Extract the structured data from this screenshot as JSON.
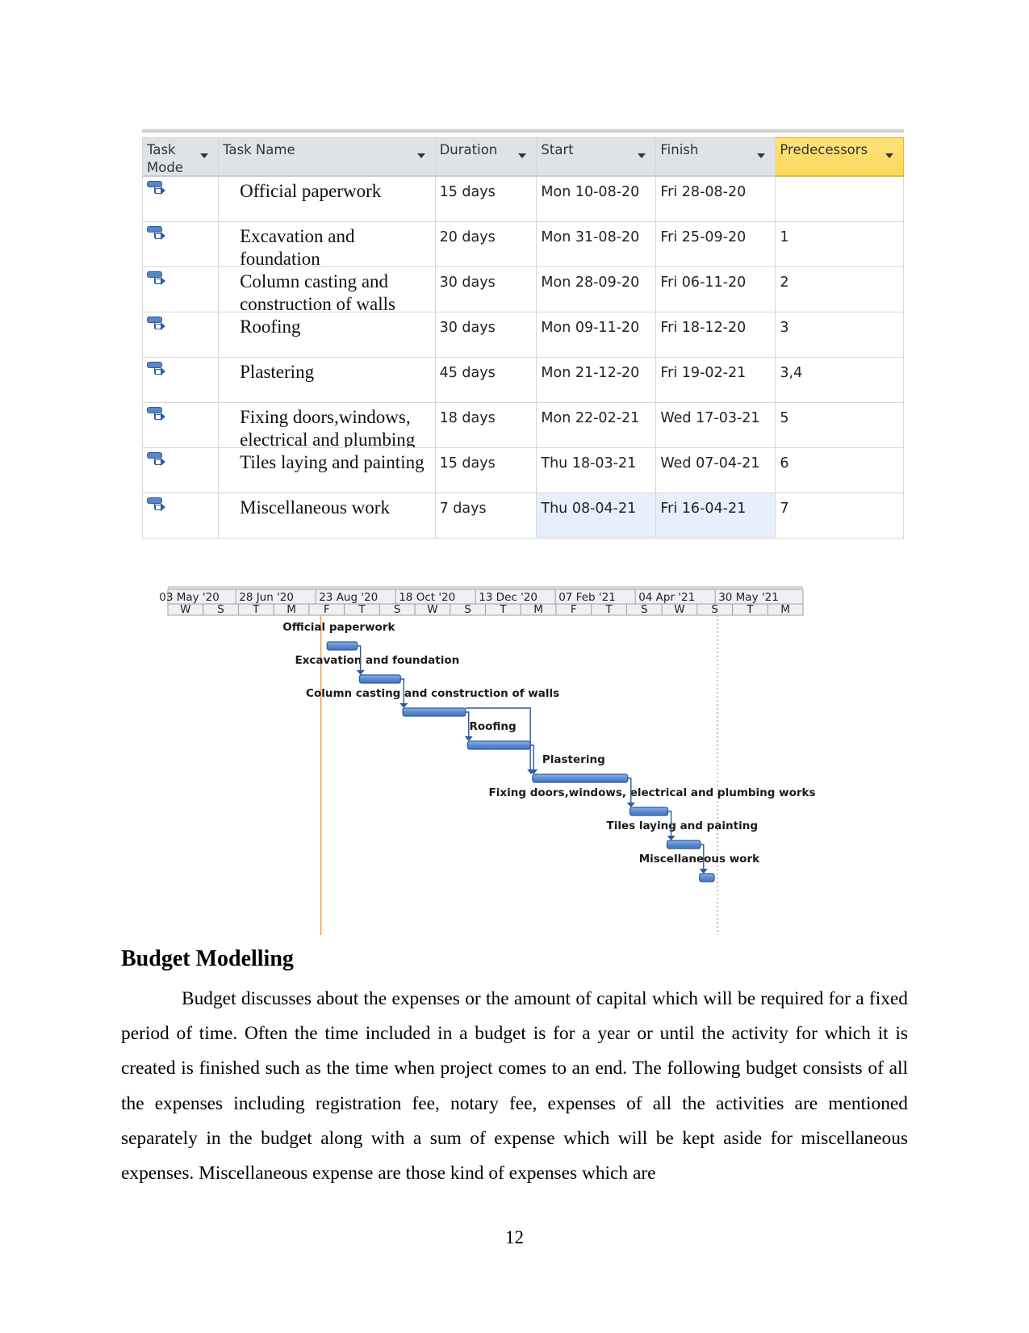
{
  "task_table": {
    "columns": [
      {
        "key": "mode",
        "label": "Task Mode",
        "line1": "Task",
        "line2": "Mode"
      },
      {
        "key": "name",
        "label": "Task Name"
      },
      {
        "key": "duration",
        "label": "Duration"
      },
      {
        "key": "start",
        "label": "Start"
      },
      {
        "key": "finish",
        "label": "Finish"
      },
      {
        "key": "predecessors",
        "label": "Predecessors"
      }
    ],
    "rows": [
      {
        "mode_icon": "auto-scheduled-task-icon",
        "name": "Official paperwork",
        "duration": "15 days",
        "start": "Mon 10-08-20",
        "finish": "Fri 28-08-20",
        "predecessors": ""
      },
      {
        "mode_icon": "auto-scheduled-task-icon",
        "name": "Excavation and foundation",
        "duration": "20 days",
        "start": "Mon 31-08-20",
        "finish": "Fri 25-09-20",
        "predecessors": "1"
      },
      {
        "mode_icon": "auto-scheduled-task-icon",
        "name": "Column casting and construction of walls",
        "duration": "30 days",
        "start": "Mon 28-09-20",
        "finish": "Fri 06-11-20",
        "predecessors": "2"
      },
      {
        "mode_icon": "auto-scheduled-task-icon",
        "name": "Roofing",
        "duration": "30 days",
        "start": "Mon 09-11-20",
        "finish": "Fri 18-12-20",
        "predecessors": "3"
      },
      {
        "mode_icon": "auto-scheduled-task-icon",
        "name": "Plastering",
        "duration": "45 days",
        "start": "Mon 21-12-20",
        "finish": "Fri 19-02-21",
        "predecessors": "3,4"
      },
      {
        "mode_icon": "auto-scheduled-task-icon",
        "name": "Fixing doors,windows, electrical and plumbing",
        "duration": "18 days",
        "start": "Mon 22-02-21",
        "finish": "Wed 17-03-21",
        "predecessors": "5"
      },
      {
        "mode_icon": "auto-scheduled-task-icon",
        "name": "Tiles laying and painting",
        "duration": "15 days",
        "start": "Thu 18-03-21",
        "finish": "Wed 07-04-21",
        "predecessors": "6"
      },
      {
        "mode_icon": "auto-scheduled-task-icon",
        "name": "Miscellaneous work",
        "duration": "7 days",
        "start": "Thu 08-04-21",
        "finish": "Fri 16-04-21",
        "predecessors": "7"
      }
    ],
    "selected_row": 7
  },
  "chart_data": {
    "type": "gantt",
    "title": "",
    "timescale_major": [
      "03 May '20",
      "28 Jun '20",
      "23 Aug '20",
      "18 Oct '20",
      "13 Dec '20",
      "07 Feb '21",
      "04 Apr '21",
      "30 May '21"
    ],
    "timescale_minor": [
      "W",
      "S",
      "T",
      "M",
      "F",
      "T",
      "S",
      "W",
      "S",
      "T",
      "M",
      "F",
      "T",
      "S",
      "W",
      "S",
      "T",
      "M"
    ],
    "axis_start": "2020-04-29",
    "axis_end": "2021-06-14",
    "today_line": "2020-08-06",
    "status_line": "2021-04-16",
    "tasks": [
      {
        "id": 1,
        "label": "Official paperwork",
        "start": "2020-08-10",
        "finish": "2020-08-28",
        "predecessors": []
      },
      {
        "id": 2,
        "label": "Excavation and foundation",
        "start": "2020-08-31",
        "finish": "2020-09-25",
        "predecessors": [
          1
        ]
      },
      {
        "id": 3,
        "label": "Column casting and construction of walls",
        "start": "2020-09-28",
        "finish": "2020-11-06",
        "predecessors": [
          2
        ]
      },
      {
        "id": 4,
        "label": "Roofing",
        "start": "2020-11-09",
        "finish": "2020-12-18",
        "predecessors": [
          3
        ]
      },
      {
        "id": 5,
        "label": "Plastering",
        "start": "2020-12-21",
        "finish": "2021-02-19",
        "predecessors": [
          3,
          4
        ]
      },
      {
        "id": 6,
        "label": "Fixing doors,windows, electrical and plumbing works",
        "start": "2021-02-22",
        "finish": "2021-03-17",
        "predecessors": [
          5
        ]
      },
      {
        "id": 7,
        "label": "Tiles laying and painting",
        "start": "2021-03-18",
        "finish": "2021-04-07",
        "predecessors": [
          6
        ]
      },
      {
        "id": 8,
        "label": "Miscellaneous work",
        "start": "2021-04-08",
        "finish": "2021-04-16",
        "predecessors": [
          7
        ]
      }
    ],
    "colors": {
      "bar": "#5b8bd0",
      "bar_border": "#2e5a9a",
      "link": "#2e5a9a",
      "today": "#f0a050",
      "status": "#999999"
    }
  },
  "section": {
    "heading": "Budget Modelling",
    "paragraph": "Budget discusses about the expenses or the amount of capital which will be required for a fixed period of time. Often the time included in a budget is for a year or until the activity for which it is created is finished such as the time when project comes to an end. The following budget consists of all the expenses including registration fee, notary fee, expenses of all the activities are mentioned separately in the budget along with a sum of expense which will be kept aside for miscellaneous expenses. Miscellaneous expense are those kind of expenses which are"
  },
  "page_number": "12"
}
